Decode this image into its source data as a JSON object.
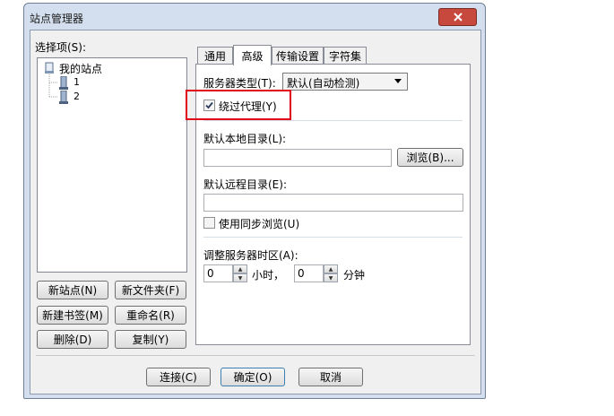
{
  "window": {
    "title": "站点管理器"
  },
  "left": {
    "select_label": "选择项(S):",
    "tree": {
      "root": "我的站点",
      "children": [
        "1",
        "2"
      ]
    },
    "buttons": {
      "new_site": "新站点(N)",
      "new_folder": "新文件夹(F)",
      "new_bookmark": "新建书签(M)",
      "rename": "重命名(R)",
      "delete": "删除(D)",
      "copy": "复制(Y)"
    }
  },
  "tabs": [
    "通用",
    "高级",
    "传输设置",
    "字符集"
  ],
  "active_tab": "高级",
  "advanced": {
    "server_type_label": "服务器类型(T):",
    "server_type_value": "默认(自动检测)",
    "bypass_proxy_label": "绕过代理(Y)",
    "bypass_proxy_checked": true,
    "local_dir_label": "默认本地目录(L):",
    "local_dir_value": "",
    "browse_button": "浏览(B)...",
    "remote_dir_label": "默认远程目录(E):",
    "remote_dir_value": "",
    "sync_browse_label": "使用同步浏览(U)",
    "sync_browse_checked": false,
    "timezone_label": "调整服务器时区(A):",
    "hours_value": "0",
    "hours_unit": "小时，",
    "minutes_value": "0",
    "minutes_unit": "分钟"
  },
  "footer": {
    "connect": "连接(C)",
    "ok": "确定(O)",
    "cancel": "取消"
  },
  "colors": {
    "highlight_box": "#e0001a",
    "close_button": "#c7483d"
  }
}
